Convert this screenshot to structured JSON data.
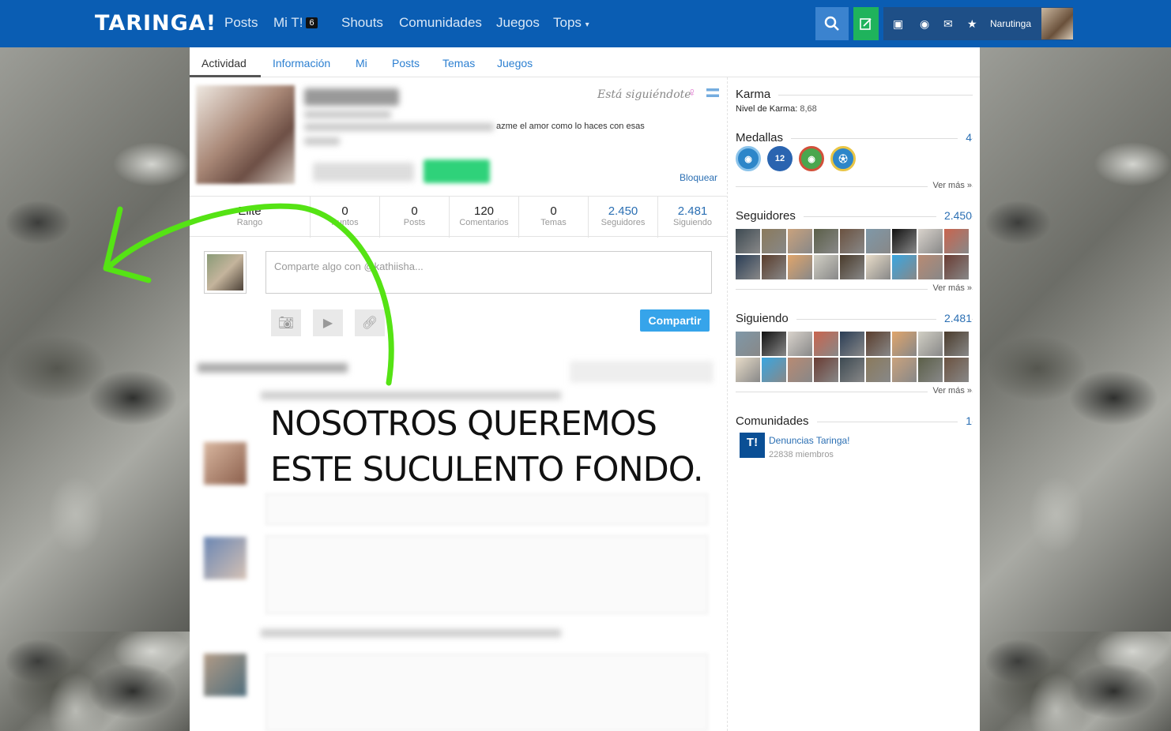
{
  "colors": {
    "brand": "#0a5db3",
    "accent_green": "#1fb35c",
    "link": "#2b6fb3",
    "arrow": "#55e314"
  },
  "header": {
    "logo": "TARINGA!",
    "nav": [
      {
        "label": "Posts"
      },
      {
        "label": "Mi T!",
        "badge": "6"
      },
      {
        "label": "Shouts"
      },
      {
        "label": "Comunidades"
      },
      {
        "label": "Juegos"
      },
      {
        "label": "Tops"
      }
    ],
    "username": "Narutinga"
  },
  "tabs": [
    "Actividad",
    "Información",
    "Mi",
    "Posts",
    "Temas",
    "Juegos"
  ],
  "profile": {
    "following_you": "Está siguiéndote",
    "bio_visible": "azme el amor como lo haces con esas",
    "block_label": "Bloquear"
  },
  "stats": [
    {
      "value": "Elite",
      "label": "Rango"
    },
    {
      "value": "0",
      "label": "Puntos"
    },
    {
      "value": "0",
      "label": "Posts"
    },
    {
      "value": "120",
      "label": "Comentarios"
    },
    {
      "value": "0",
      "label": "Temas"
    },
    {
      "value": "2.450",
      "label": "Seguidores"
    },
    {
      "value": "2.481",
      "label": "Siguiendo"
    }
  ],
  "share": {
    "placeholder": "Comparte algo con @kathiisha...",
    "button": "Compartir"
  },
  "caption": {
    "line1": "NOSOTROS QUEREMOS",
    "line2": "ESTE SUCULENTO FONDO."
  },
  "sidebar": {
    "karma_title": "Karma",
    "karma_label": "Nivel de Karma:",
    "karma_value": "8,68",
    "medals_title": "Medallas",
    "medals_count": "4",
    "medal_12": "12",
    "see_more": "Ver más »",
    "followers_title": "Seguidores",
    "followers_count": "2.450",
    "following_title": "Siguiendo",
    "following_count": "2.481",
    "communities_title": "Comunidades",
    "communities_count": "1",
    "community_logo": "T!",
    "community_name": "Denuncias Taringa!",
    "community_members": "22838 miembros"
  }
}
